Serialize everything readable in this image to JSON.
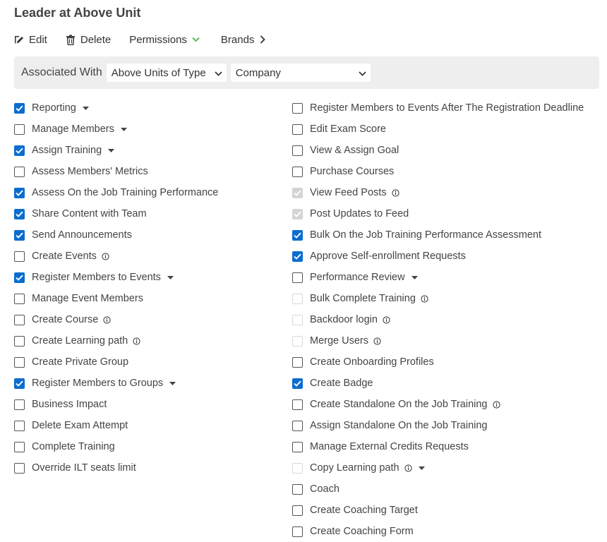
{
  "title": "Leader at Above Unit",
  "actions": {
    "edit": "Edit",
    "delete": "Delete",
    "permissions": "Permissions",
    "brands": "Brands"
  },
  "colors": {
    "checked": "#0b6dcf",
    "permissions_chevron": "#5cb85c"
  },
  "association": {
    "label": "Associated With",
    "type_select": "Above Units of Type",
    "company_select": "Company"
  },
  "permissions_left": [
    {
      "label": "Reporting",
      "checked": true,
      "disabled": false,
      "dropdown": true,
      "info": false
    },
    {
      "label": "Manage Members",
      "checked": false,
      "disabled": false,
      "dropdown": true,
      "info": false
    },
    {
      "label": "Assign Training",
      "checked": true,
      "disabled": false,
      "dropdown": true,
      "info": false
    },
    {
      "label": "Assess Members' Metrics",
      "checked": false,
      "disabled": false,
      "dropdown": false,
      "info": false
    },
    {
      "label": "Assess On the Job Training Performance",
      "checked": true,
      "disabled": false,
      "dropdown": false,
      "info": false
    },
    {
      "label": "Share Content with Team",
      "checked": true,
      "disabled": false,
      "dropdown": false,
      "info": false
    },
    {
      "label": "Send Announcements",
      "checked": true,
      "disabled": false,
      "dropdown": false,
      "info": false
    },
    {
      "label": "Create Events",
      "checked": false,
      "disabled": false,
      "dropdown": false,
      "info": true
    },
    {
      "label": "Register Members to Events",
      "checked": true,
      "disabled": false,
      "dropdown": true,
      "info": false
    },
    {
      "label": "Manage Event Members",
      "checked": false,
      "disabled": false,
      "dropdown": false,
      "info": false
    },
    {
      "label": "Create Course",
      "checked": false,
      "disabled": false,
      "dropdown": false,
      "info": true
    },
    {
      "label": "Create Learning path",
      "checked": false,
      "disabled": false,
      "dropdown": false,
      "info": true
    },
    {
      "label": "Create Private Group",
      "checked": false,
      "disabled": false,
      "dropdown": false,
      "info": false
    },
    {
      "label": "Register Members to Groups",
      "checked": true,
      "disabled": false,
      "dropdown": true,
      "info": false
    },
    {
      "label": "Business Impact",
      "checked": false,
      "disabled": false,
      "dropdown": false,
      "info": false
    },
    {
      "label": "Delete Exam Attempt",
      "checked": false,
      "disabled": false,
      "dropdown": false,
      "info": false
    },
    {
      "label": "Complete Training",
      "checked": false,
      "disabled": false,
      "dropdown": false,
      "info": false
    },
    {
      "label": "Override ILT seats limit",
      "checked": false,
      "disabled": false,
      "dropdown": false,
      "info": false
    }
  ],
  "permissions_right": [
    {
      "label": "Register Members to Events After The Registration Deadline",
      "checked": false,
      "disabled": false,
      "dropdown": false,
      "info": false
    },
    {
      "label": "Edit Exam Score",
      "checked": false,
      "disabled": false,
      "dropdown": false,
      "info": false
    },
    {
      "label": "View & Assign Goal",
      "checked": false,
      "disabled": false,
      "dropdown": false,
      "info": false
    },
    {
      "label": "Purchase Courses",
      "checked": false,
      "disabled": false,
      "dropdown": false,
      "info": false
    },
    {
      "label": "View Feed Posts",
      "checked": true,
      "disabled": true,
      "dropdown": false,
      "info": true
    },
    {
      "label": "Post Updates to Feed",
      "checked": true,
      "disabled": true,
      "dropdown": false,
      "info": false
    },
    {
      "label": "Bulk On the Job Training Performance Assessment",
      "checked": true,
      "disabled": false,
      "dropdown": false,
      "info": false
    },
    {
      "label": "Approve Self-enrollment Requests",
      "checked": true,
      "disabled": false,
      "dropdown": false,
      "info": false
    },
    {
      "label": "Performance Review",
      "checked": false,
      "disabled": false,
      "dropdown": true,
      "info": false
    },
    {
      "label": "Bulk Complete Training",
      "checked": false,
      "disabled": true,
      "dropdown": false,
      "info": true
    },
    {
      "label": "Backdoor login",
      "checked": false,
      "disabled": true,
      "dropdown": false,
      "info": true
    },
    {
      "label": "Merge Users",
      "checked": false,
      "disabled": true,
      "dropdown": false,
      "info": true
    },
    {
      "label": "Create Onboarding Profiles",
      "checked": false,
      "disabled": false,
      "dropdown": false,
      "info": false
    },
    {
      "label": "Create Badge",
      "checked": true,
      "disabled": false,
      "dropdown": false,
      "info": false
    },
    {
      "label": "Create Standalone On the Job Training",
      "checked": false,
      "disabled": false,
      "dropdown": false,
      "info": true
    },
    {
      "label": "Assign Standalone On the Job Training",
      "checked": false,
      "disabled": false,
      "dropdown": false,
      "info": false
    },
    {
      "label": "Manage External Credits Requests",
      "checked": false,
      "disabled": false,
      "dropdown": false,
      "info": false
    },
    {
      "label": "Copy Learning path",
      "checked": false,
      "disabled": true,
      "dropdown": true,
      "info": true
    },
    {
      "label": "Coach",
      "checked": false,
      "disabled": false,
      "dropdown": false,
      "info": false
    },
    {
      "label": "Create Coaching Target",
      "checked": false,
      "disabled": false,
      "dropdown": false,
      "info": false
    },
    {
      "label": "Create Coaching Form",
      "checked": false,
      "disabled": false,
      "dropdown": false,
      "info": false
    }
  ]
}
